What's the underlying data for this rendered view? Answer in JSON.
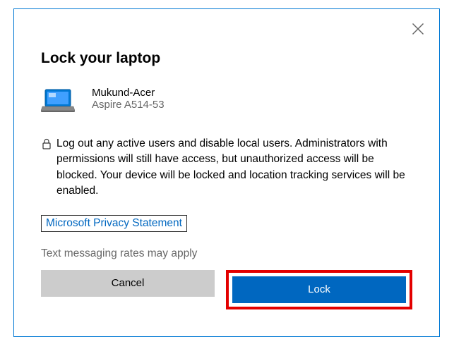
{
  "dialog": {
    "title": "Lock your laptop",
    "device": {
      "name": "Mukund-Acer",
      "model": "Aspire A514-53"
    },
    "description": "Log out any active users and disable local users. Administrators with permissions will still have access, but unauthorized access will be blocked. Your device will be locked and location tracking services will be enabled.",
    "privacy_link": "Microsoft Privacy Statement",
    "rates_note": "Text messaging rates may apply",
    "buttons": {
      "cancel": "Cancel",
      "lock": "Lock"
    }
  }
}
